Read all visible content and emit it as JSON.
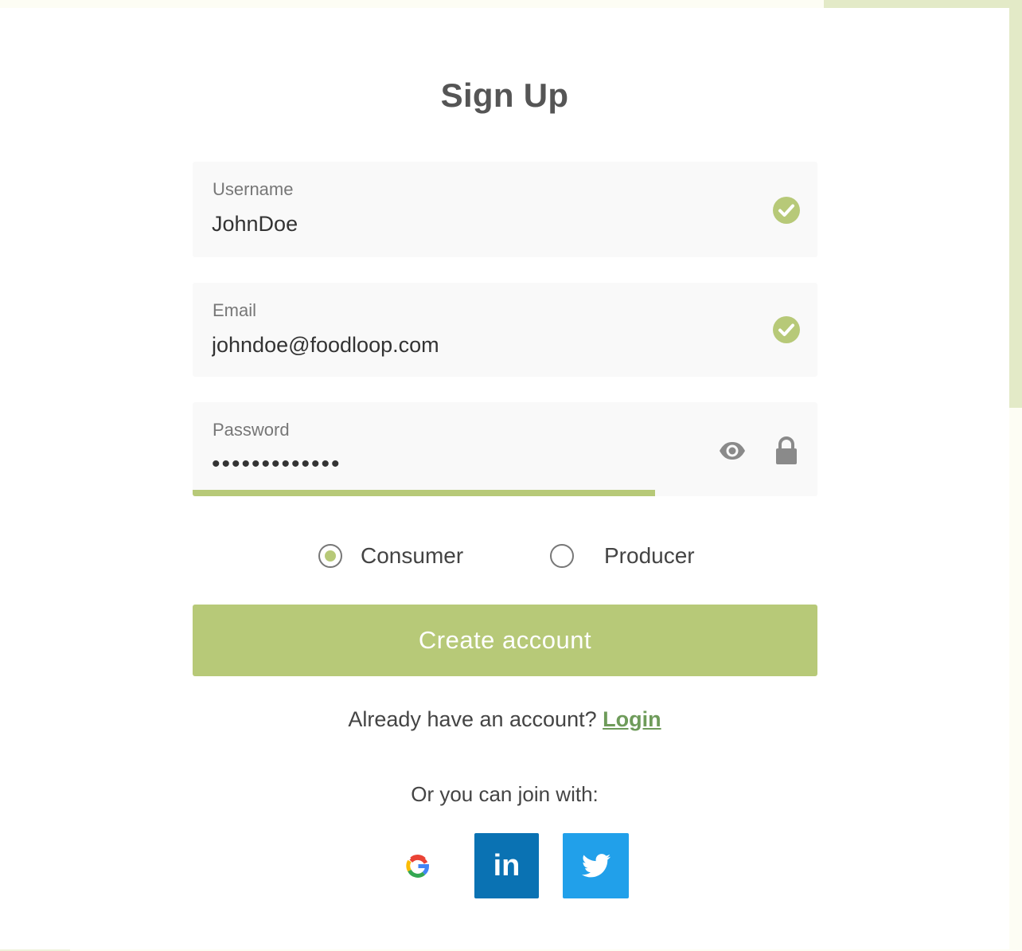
{
  "title": "Sign Up",
  "colors": {
    "accent": "#b7c978",
    "link": "#6e9b5a",
    "linkedin": "#0a72b3",
    "twitter": "#21a0ea"
  },
  "form": {
    "username": {
      "label": "Username",
      "value": "JohnDoe",
      "status_icon": "check-circle-icon"
    },
    "email": {
      "label": "Email",
      "value": "johndoe@foodloop.com",
      "status_icon": "check-circle-icon"
    },
    "password": {
      "label": "Password",
      "value": "•••••••••••••",
      "strength_fraction": 0.74,
      "icons": [
        "eye-icon",
        "lock-icon"
      ]
    }
  },
  "roles": {
    "options": [
      {
        "label": "Consumer",
        "checked": true
      },
      {
        "label": "Producer",
        "checked": false
      }
    ]
  },
  "create_button": "Create account",
  "login": {
    "prompt": "Already have an account?",
    "link": "Login"
  },
  "join_text": "Or you can join with:",
  "social": {
    "google_icon": "G",
    "linkedin_icon": "in",
    "twitter_icon": "twitter-bird-icon"
  }
}
